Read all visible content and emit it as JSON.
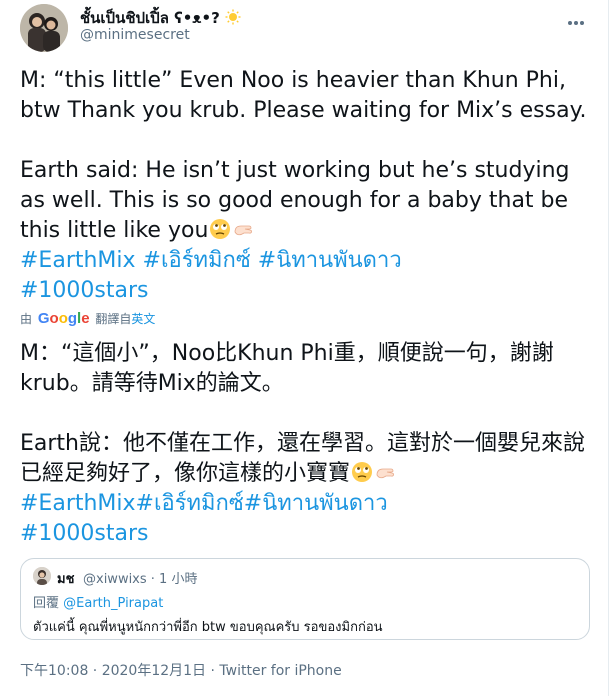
{
  "author": {
    "name": "ชั้นเป็นชิปเปิ้ล ʕ•ᴥ•?",
    "handle": "@minimesecret",
    "more_icon": "more-horizontal-icon"
  },
  "tweet": {
    "line1": "M: “this little” Even Noo is heavier than Khun Phi, btw Thank you krub. Please waiting for Mix’s essay.",
    "line2": "Earth said: He isn’t just working but he’s studying as well. This is so good enough for a baby that be this little like you",
    "hashtags_row1": "#EarthMix #เอิร์ทมิกซ์ #นิทานพันดาว",
    "hashtag_row2": "#1000stars"
  },
  "translation": {
    "by_prefix": "由",
    "google": "Google",
    "translated": "翻譯自",
    "source_lang": "英文",
    "line1": "M：“這個小”，Noo比Khun Phi重，順便說一句，謝謝krub。請等待Mix的論文。",
    "line2": " Earth說：他不僅在工作，還在學習。這對於一個嬰兒來說已經足夠好了，像你這樣的小寶寶",
    "hashtags_row1": "#EarthMix#เอิร์ทมิกซ์#นิทานพันดาว",
    "hashtag_row2": "#1000stars"
  },
  "quoted": {
    "name": "มช",
    "handle": "@xiwwixs · 1 小時",
    "reply_prefix": "回覆",
    "reply_to": "@Earth_Pirapat",
    "text": "ตัวแค่นี้ คุณพี่หนูหนักกว่าพี่อีก btw ขอบคุณครับ รอของมิกก่อน"
  },
  "meta": {
    "time": "下午10:08 · 2020年12月1日 · ",
    "source": "Twitter for iPhone"
  },
  "colors": {
    "link": "#1b95e0",
    "secondary": "#5b7083",
    "text": "#0f1419",
    "border": "#ccd6dd"
  },
  "icons": [
    "sun-emoji",
    "rolling-eyes-emoji",
    "pinching-hand-emoji",
    "google-logo"
  ]
}
